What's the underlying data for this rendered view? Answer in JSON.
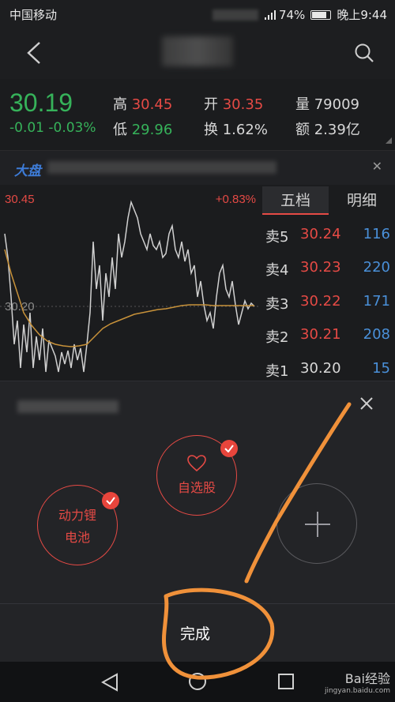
{
  "status_bar": {
    "carrier": "中国移动",
    "battery": "74%",
    "time": "晚上9:44"
  },
  "quote": {
    "price": "30.19",
    "change": "-0.01 -0.03%",
    "high_label": "高",
    "high_value": "30.45",
    "low_label": "低",
    "low_value": "29.96",
    "open_label": "开",
    "open_value": "30.35",
    "turnover_label": "换",
    "turnover_value": "1.62%",
    "volume_label": "量",
    "volume_value": "79009",
    "amount_label": "额",
    "amount_value": "2.39亿"
  },
  "news": {
    "tag": "大盘"
  },
  "chart": {
    "top_price": "30.45",
    "top_pct": "+0.83%",
    "mid_price": "30.20"
  },
  "depth": {
    "tabs": [
      "五档",
      "明细"
    ],
    "rows": [
      {
        "label": "卖5",
        "price": "30.24",
        "volume": "116",
        "color": "#e54a45"
      },
      {
        "label": "卖4",
        "price": "30.23",
        "volume": "220",
        "color": "#e54a45"
      },
      {
        "label": "卖3",
        "price": "30.22",
        "volume": "171",
        "color": "#e54a45"
      },
      {
        "label": "卖2",
        "price": "30.21",
        "volume": "208",
        "color": "#e54a45"
      },
      {
        "label": "卖1",
        "price": "30.20",
        "volume": "15",
        "color": "#d8d8d8"
      }
    ]
  },
  "panel": {
    "groups": [
      {
        "label_line1": "动力锂",
        "label_line2": "电池",
        "checked": true
      },
      {
        "label": "自选股",
        "icon": "heart-icon",
        "checked": true
      }
    ],
    "done_label": "完成"
  },
  "watermark": {
    "brand": "Bai经验",
    "url": "jingyan.baidu.com"
  },
  "colors": {
    "up": "#e54a45",
    "down": "#36b25a",
    "annotation": "#f0913a",
    "volume": "#4a90d9"
  }
}
